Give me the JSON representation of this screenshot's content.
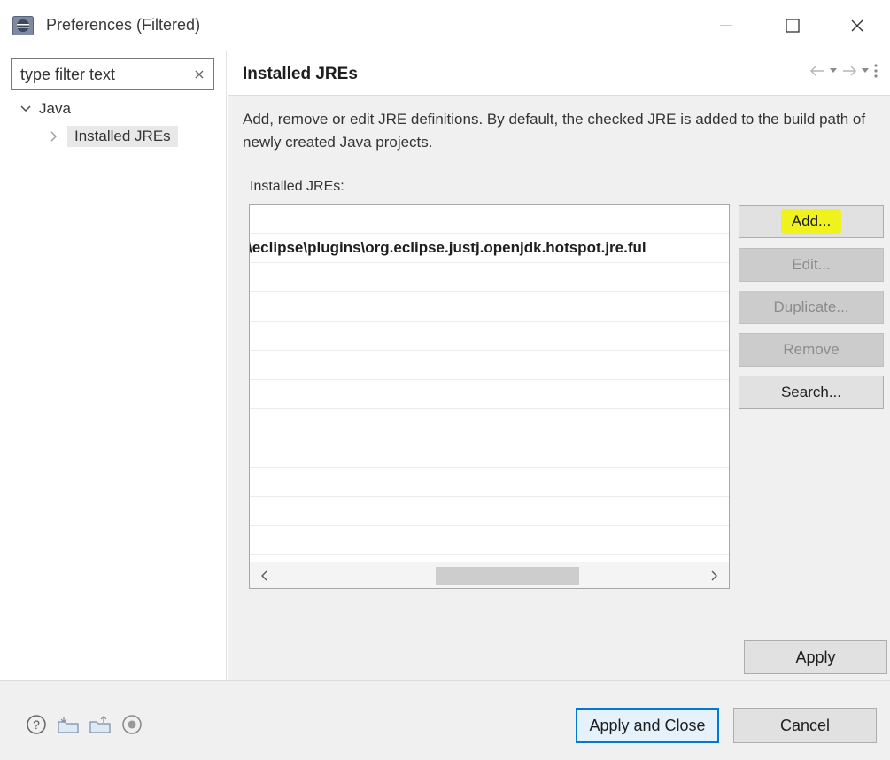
{
  "window": {
    "title": "Preferences (Filtered)",
    "icon": "eclipse-app-icon",
    "controls": {
      "minimize_icon": "minimize-icon",
      "maximize_icon": "maximize-icon",
      "close_icon": "close-icon"
    }
  },
  "sidebar": {
    "filter": {
      "value": "type filter text",
      "clear_icon": "clear-icon"
    },
    "tree": [
      {
        "label": "Java",
        "state": "expanded",
        "children": [
          {
            "label": "Installed JREs",
            "selected": true
          }
        ]
      }
    ]
  },
  "main": {
    "title": "Installed JREs",
    "nav": [
      "back-icon",
      "back-menu-icon",
      "forward-icon",
      "forward-menu-icon",
      "view-menu-icon"
    ],
    "description": "Add, remove or edit JRE definitions. By default, the checked JRE is added to the build path of newly created Java projects.",
    "list_label": "Installed JREs:",
    "jre_rows": [
      "",
      "\\eclipse\\plugins\\org.eclipse.justj.openjdk.hotspot.jre.ful",
      "",
      "",
      "",
      "",
      "",
      "",
      "",
      "",
      "",
      ""
    ],
    "buttons": [
      {
        "label": "Add...",
        "enabled": true,
        "highlighted": true
      },
      {
        "label": "Edit...",
        "enabled": false
      },
      {
        "label": "Duplicate...",
        "enabled": false
      },
      {
        "label": "Remove",
        "enabled": false
      },
      {
        "label": "Search...",
        "enabled": true
      }
    ],
    "apply_label": "Apply"
  },
  "footer": {
    "icons": [
      "help-icon",
      "import-icon",
      "export-icon",
      "record-icon"
    ],
    "apply_close_label": "Apply and Close",
    "cancel_label": "Cancel"
  },
  "colors": {
    "highlight": "#f0f21e",
    "default_button_border": "#0078d7",
    "pane_bg": "#f0f0f0"
  }
}
